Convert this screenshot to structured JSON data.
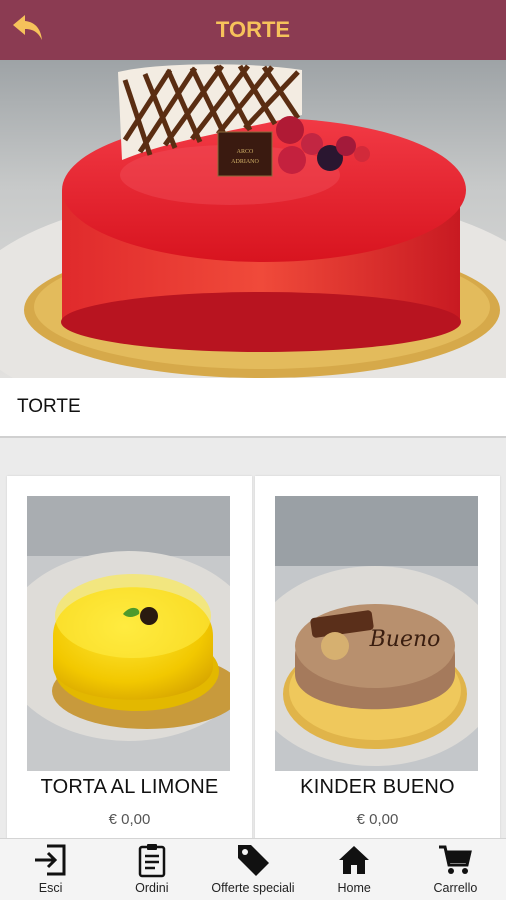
{
  "header": {
    "title": "TORTE",
    "back_icon": "back-arrow-icon",
    "accent": "#8b3b52",
    "title_color": "#f6c25b"
  },
  "hero": {
    "image": "raspberry-glazed-cake-photo",
    "plaque_text": "ARCO ADRIANO"
  },
  "section": {
    "label": "TORTE"
  },
  "products": [
    {
      "name": "TORTA AL LIMONE",
      "price": "€ 0,00",
      "image": "lemon-cake-photo"
    },
    {
      "name": "KINDER BUENO",
      "price": "€ 0,00",
      "image": "kinder-bueno-cake-photo",
      "cake_script": "Bueno"
    }
  ],
  "bottom_nav": {
    "items": [
      {
        "label": "Esci",
        "icon": "exit-icon"
      },
      {
        "label": "Ordini",
        "icon": "clipboard-icon"
      },
      {
        "label": "Offerte speciali",
        "icon": "tag-icon"
      },
      {
        "label": "Home",
        "icon": "home-icon"
      },
      {
        "label": "Carrello",
        "icon": "cart-icon"
      }
    ]
  }
}
